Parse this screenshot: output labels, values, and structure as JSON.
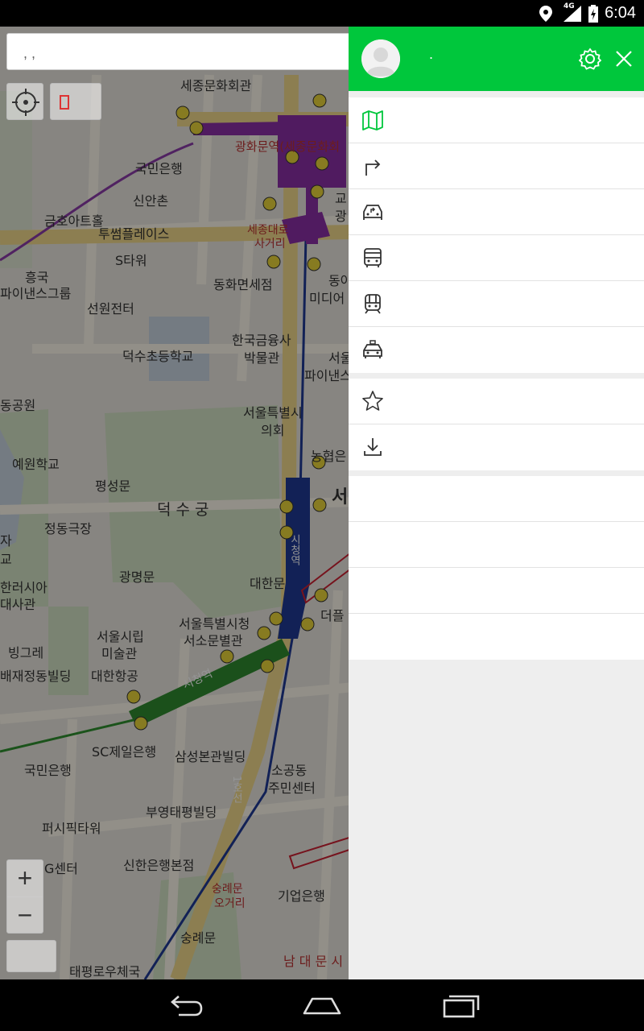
{
  "status_bar": {
    "time": "6:04",
    "network": "4G",
    "icons": [
      "location-icon",
      "signal-icon",
      "battery-icon"
    ]
  },
  "search": {
    "placeholder": ", ,"
  },
  "map": {
    "labels": {
      "l1": "세종문화회관",
      "l2": "광화문역(세종문화회",
      "l3": "국민은행",
      "l4": "신안촌",
      "l5": "금호아트홀",
      "l6": "투썸플레이스",
      "l7": "세종대로",
      "l8": "사거리",
      "l9": "S타워",
      "l10": "동화면세점",
      "l11": "흥국",
      "l12": "파이낸스그룹",
      "l13": "선원전터",
      "l14": "한국금융사",
      "l15": "박물관",
      "l16": "덕수초등학교",
      "l17": "동공원",
      "l18": "서울특별시",
      "l19": "의회",
      "l20": "예원학교",
      "l21": "평성문",
      "l22": "덕 수 궁",
      "l23": "정동극장",
      "l24": "자",
      "l25": "교",
      "l26": "광명문",
      "l27": "대한문",
      "l28": "한러시아",
      "l29": "대사관",
      "l30": "서울특별시청",
      "l31": "서소문별관",
      "l32": "서울시립",
      "l33": "미술관",
      "l34": "빙그레",
      "l35": "배재정동빌딩",
      "l36": "대한항공",
      "l37": "시청역",
      "l38": "SC제일은행",
      "l39": "삼성본관빌딩",
      "l40": "국민은행",
      "l41": "소공동",
      "l42": "주민센터",
      "l43": "부영태평빌딩",
      "l44": "퍼시픽타워",
      "l45": "G센터",
      "l46": "신한은행본점",
      "l47": "숭례문",
      "l48": "오거리",
      "l49": "기업은행",
      "l50": "숭례문",
      "l51": "태평로우체국",
      "l52": "남 대 문 시",
      "l53": "교",
      "l54": "광",
      "l55": "동아",
      "l56": "미디어",
      "l57": "서울",
      "l58": "파이낸스",
      "l59": "농협은",
      "l60": "서",
      "l61": "더플",
      "l62": "시청역",
      "l63": "1호선"
    },
    "zoom": {
      "plus": "+",
      "minus": "−"
    }
  },
  "drawer": {
    "user_name": ".",
    "settings_icon": "gear-icon",
    "close_icon": "close-icon",
    "accent": "#00c73c",
    "menu_main": [
      {
        "icon": "map-icon",
        "label": ""
      },
      {
        "icon": "directions-icon",
        "label": ""
      },
      {
        "icon": "car-navigation-icon",
        "label": ""
      },
      {
        "icon": "bus-icon",
        "label": ""
      },
      {
        "icon": "subway-icon",
        "label": ""
      },
      {
        "icon": "taxi-icon",
        "label": ""
      }
    ],
    "menu_secondary": [
      {
        "icon": "star-icon",
        "label": ""
      },
      {
        "icon": "download-icon",
        "label": ""
      }
    ],
    "menu_tertiary": [
      {
        "label": ""
      },
      {
        "label": ""
      },
      {
        "label": ""
      },
      {
        "label": ""
      }
    ]
  },
  "nav_bar": {
    "buttons": [
      "back-icon",
      "home-icon",
      "recent-apps-icon"
    ]
  }
}
